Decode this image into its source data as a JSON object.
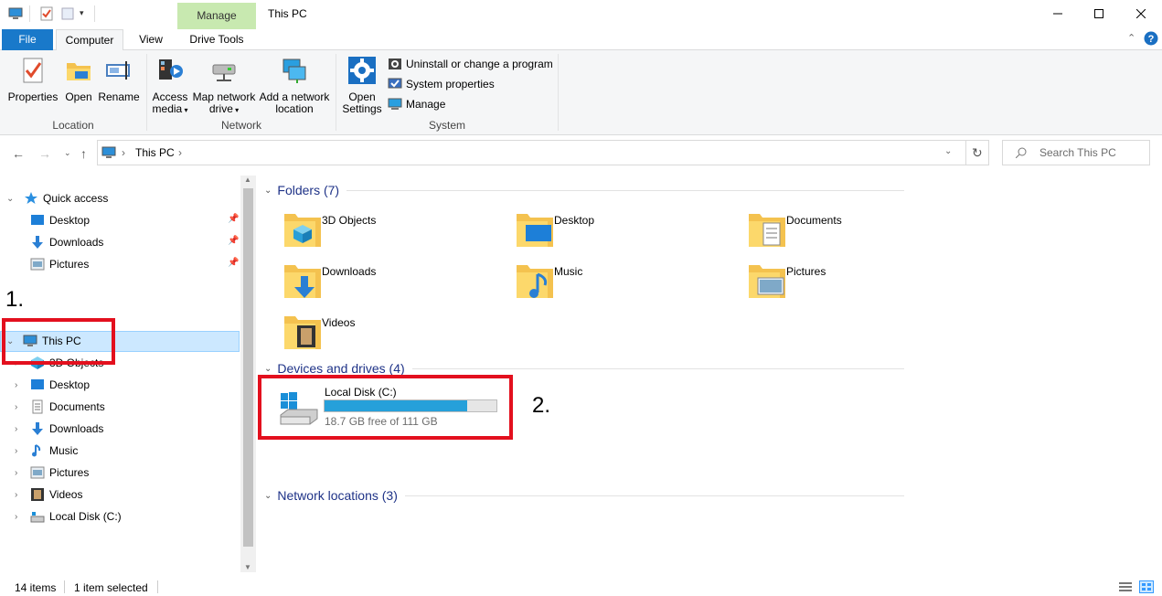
{
  "titlebar": {
    "title": "This PC",
    "context_tab": "Manage",
    "minimize_icon": "minimize-icon",
    "maximize_icon": "maximize-icon",
    "close_icon": "close-icon"
  },
  "tabs": {
    "file": "File",
    "computer": "Computer",
    "view": "View",
    "drive_tools": "Drive Tools"
  },
  "ribbon": {
    "location": {
      "label": "Location",
      "properties": "Properties",
      "open": "Open",
      "rename": "Rename"
    },
    "network": {
      "label": "Network",
      "access_media_1": "Access",
      "access_media_2": "media",
      "map_drive_1": "Map network",
      "map_drive_2": "drive",
      "add_location_1": "Add a network",
      "add_location_2": "location"
    },
    "system": {
      "label": "System",
      "open_settings_1": "Open",
      "open_settings_2": "Settings",
      "uninstall": "Uninstall or change a program",
      "system_properties": "System properties",
      "manage": "Manage"
    }
  },
  "address": {
    "path": "This PC",
    "search_placeholder": "Search This PC"
  },
  "nav": {
    "quick_access": "Quick access",
    "quick_items": [
      "Desktop",
      "Downloads",
      "Pictures"
    ],
    "this_pc": "This PC",
    "pc_items": [
      "3D Objects",
      "Desktop",
      "Documents",
      "Downloads",
      "Music",
      "Pictures",
      "Videos",
      "Local Disk (C:)"
    ]
  },
  "content": {
    "folders_header": "Folders (7)",
    "folders": [
      "3D Objects",
      "Desktop",
      "Documents",
      "Downloads",
      "Music",
      "Pictures",
      "Videos"
    ],
    "devices_header": "Devices and drives (4)",
    "drive": {
      "name": "Local Disk (C:)",
      "free": "18.7 GB free of 111 GB",
      "used_fraction": 0.83
    },
    "network_header": "Network locations (3)"
  },
  "annotations": {
    "step1": "1.",
    "step2": "2.",
    "highlight_color": "#e3101e"
  },
  "status": {
    "items": "14 items",
    "selected": "1 item selected"
  }
}
